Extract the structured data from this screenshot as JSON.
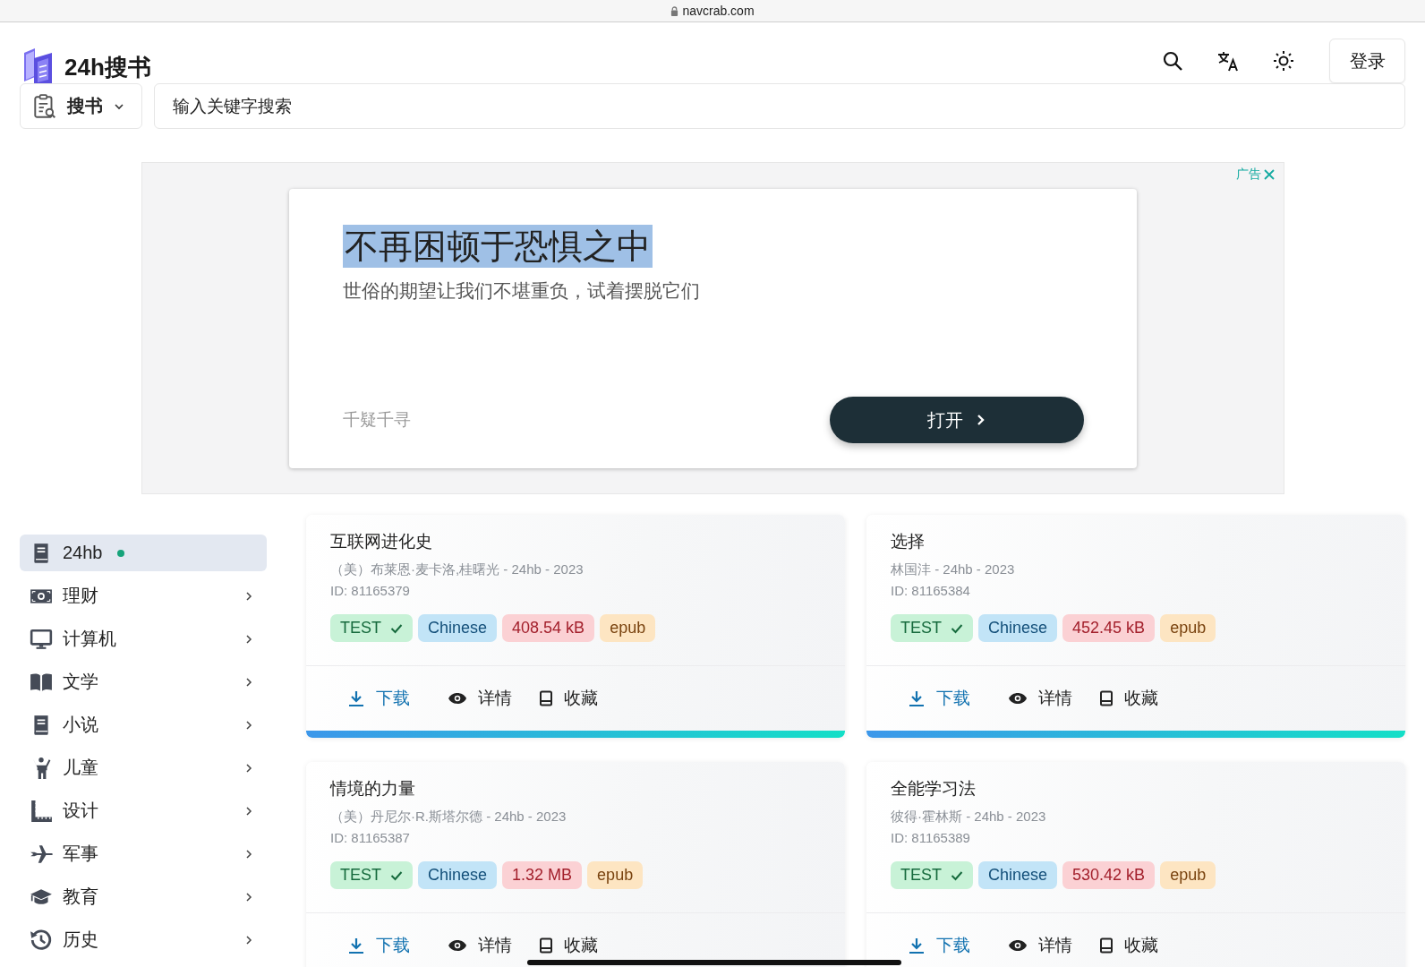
{
  "browser": {
    "address": "navcrab.com"
  },
  "header": {
    "site_title": "24h搜书",
    "login": "登录"
  },
  "search": {
    "scope": "搜书",
    "placeholder": "输入关键字搜索"
  },
  "ad": {
    "label": "广告",
    "headline": "不再困顿于恐惧之中",
    "headline_highlighted": true,
    "subtitle": "世俗的期望让我们不堪重负，试着摆脱它们",
    "advertiser": "千疑千寻",
    "button": "打开"
  },
  "sidebar": {
    "items": [
      {
        "label": "24hb",
        "kind": "source",
        "selected": true
      },
      {
        "label": "理财",
        "kind": "category",
        "selected": false
      },
      {
        "label": "计算机",
        "kind": "category",
        "selected": false
      },
      {
        "label": "文学",
        "kind": "category",
        "selected": false
      },
      {
        "label": "小说",
        "kind": "category",
        "selected": false
      },
      {
        "label": "儿童",
        "kind": "category",
        "selected": false
      },
      {
        "label": "设计",
        "kind": "category",
        "selected": false
      },
      {
        "label": "军事",
        "kind": "category",
        "selected": false
      },
      {
        "label": "教育",
        "kind": "category",
        "selected": false
      },
      {
        "label": "历史",
        "kind": "category",
        "selected": false
      }
    ]
  },
  "books": [
    {
      "title": "互联网进化史",
      "meta": "（美）布莱恩·麦卡洛,桂曙光 - 24hb - 2023",
      "id": "ID: 81165379",
      "tags": [
        {
          "kind": "status",
          "text": "TEST"
        },
        {
          "kind": "language",
          "text": "Chinese"
        },
        {
          "kind": "size",
          "text": "408.54 kB"
        },
        {
          "kind": "format",
          "text": "epub"
        }
      ],
      "actions": [
        {
          "kind": "download",
          "label": "下载"
        },
        {
          "kind": "details",
          "label": "详情"
        },
        {
          "kind": "favorite",
          "label": "收藏"
        }
      ]
    },
    {
      "title": "选择",
      "meta": "林国沣 - 24hb - 2023",
      "id": "ID: 81165384",
      "tags": [
        {
          "kind": "status",
          "text": "TEST"
        },
        {
          "kind": "language",
          "text": "Chinese"
        },
        {
          "kind": "size",
          "text": "452.45 kB"
        },
        {
          "kind": "format",
          "text": "epub"
        }
      ],
      "actions": [
        {
          "kind": "download",
          "label": "下载"
        },
        {
          "kind": "details",
          "label": "详情"
        },
        {
          "kind": "favorite",
          "label": "收藏"
        }
      ]
    },
    {
      "title": "情境的力量",
      "meta": "（美）丹尼尔·R.斯塔尔德 - 24hb - 2023",
      "id": "ID: 81165387",
      "tags": [
        {
          "kind": "status",
          "text": "TEST"
        },
        {
          "kind": "language",
          "text": "Chinese"
        },
        {
          "kind": "size",
          "text": "1.32 MB"
        },
        {
          "kind": "format",
          "text": "epub"
        }
      ],
      "actions": [
        {
          "kind": "download",
          "label": "下载"
        },
        {
          "kind": "details",
          "label": "详情"
        },
        {
          "kind": "favorite",
          "label": "收藏"
        }
      ]
    },
    {
      "title": "全能学习法",
      "meta": "彼得·霍林斯 - 24hb - 2023",
      "id": "ID: 81165389",
      "tags": [
        {
          "kind": "status",
          "text": "TEST"
        },
        {
          "kind": "language",
          "text": "Chinese"
        },
        {
          "kind": "size",
          "text": "530.42 kB"
        },
        {
          "kind": "format",
          "text": "epub"
        }
      ],
      "actions": [
        {
          "kind": "download",
          "label": "下载"
        },
        {
          "kind": "details",
          "label": "详情"
        },
        {
          "kind": "favorite",
          "label": "收藏"
        }
      ]
    }
  ]
}
